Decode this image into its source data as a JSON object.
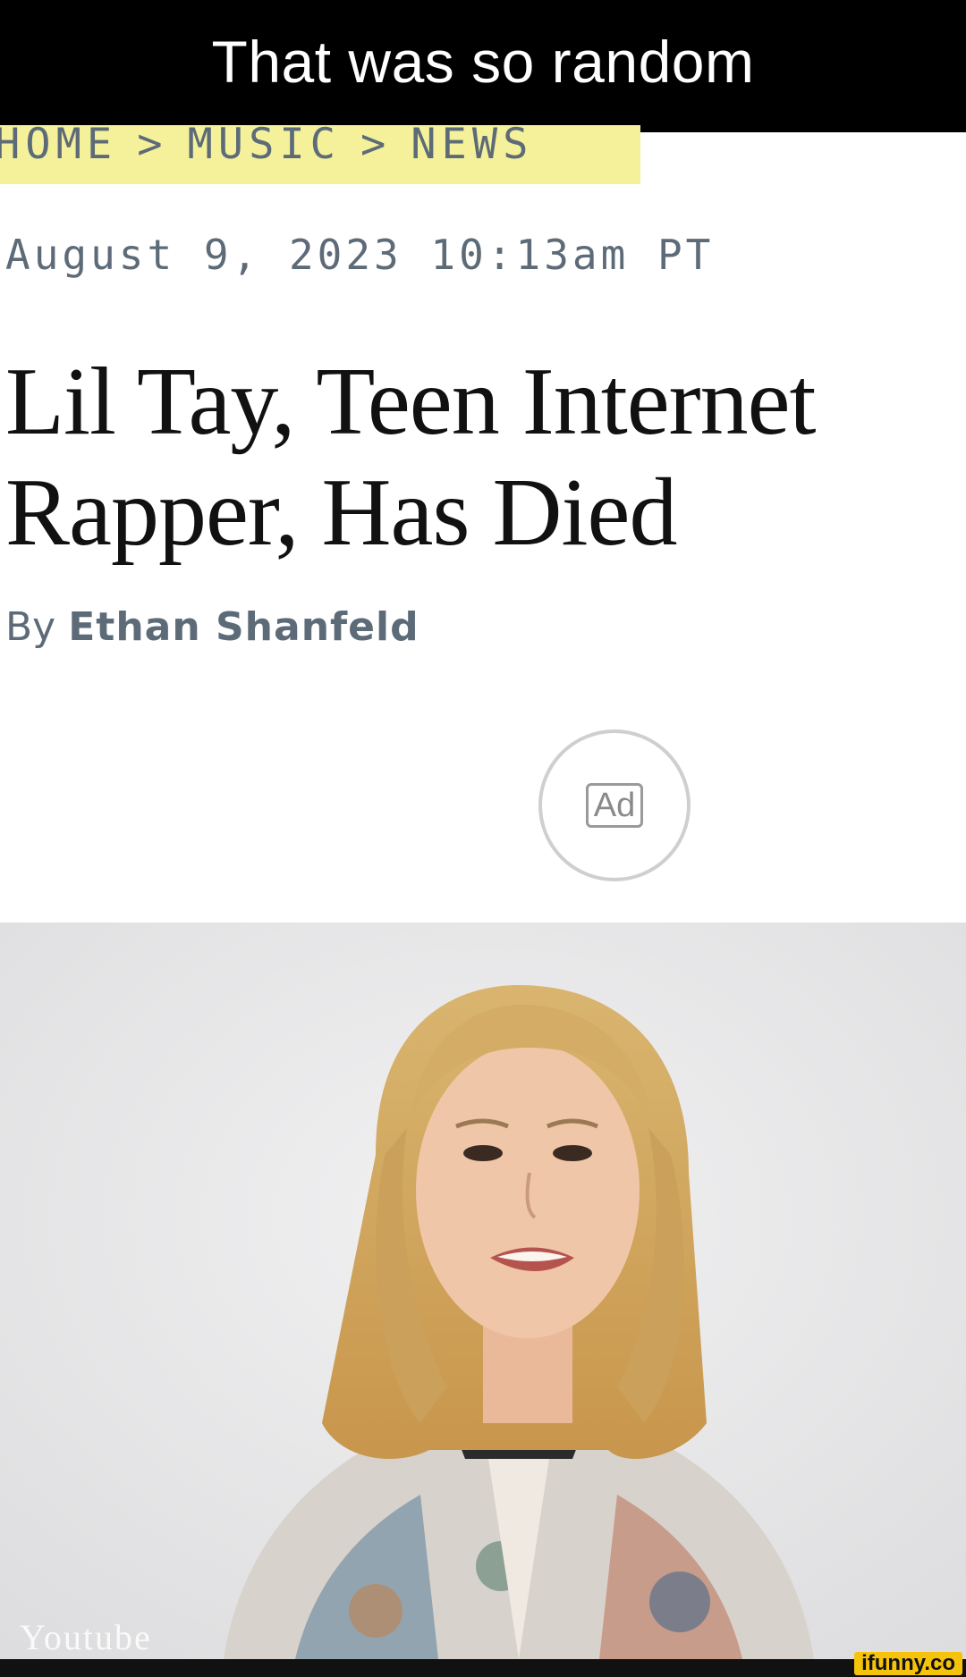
{
  "caption": {
    "text": "That was so random"
  },
  "breadcrumb": {
    "items": [
      "HOME",
      "MUSIC",
      "NEWS"
    ],
    "separator": ">"
  },
  "article": {
    "date": "August 9, 2023 10:13am PT",
    "headline": "Lil Tay, Teen Internet Rapper, Has Died",
    "byline_prefix": "By",
    "author": "Ethan Shanfeld"
  },
  "ad": {
    "label": "Ad"
  },
  "photo": {
    "credit": "Youtube",
    "icon": "portrait-photo"
  },
  "watermark": {
    "text": "ifunny.co"
  },
  "colors": {
    "highlight": "#f4f19a",
    "meta_text": "#5d6b78",
    "caption_bg": "#000000",
    "ifunny_badge": "#f6c30c"
  }
}
